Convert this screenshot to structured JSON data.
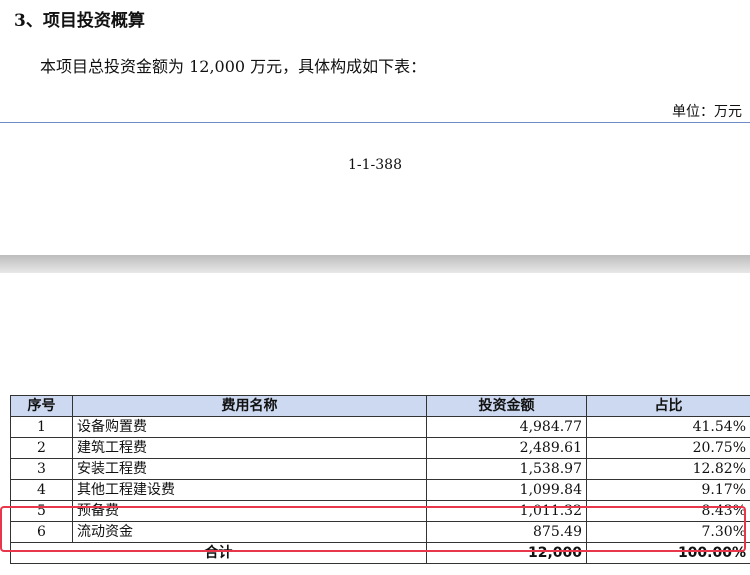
{
  "section_heading": "3、项目投资概算",
  "paragraph": "本项目总投资金额为 12,000 万元，具体构成如下表：",
  "unit_label": "单位：万元",
  "page_number": "1-1-388",
  "table": {
    "headers": [
      "序号",
      "费用名称",
      "投资金额",
      "占比"
    ],
    "rows": [
      [
        "1",
        "设备购置费",
        "4,984.77",
        "41.54%"
      ],
      [
        "2",
        "建筑工程费",
        "2,489.61",
        "20.75%"
      ],
      [
        "3",
        "安装工程费",
        "1,538.97",
        "12.82%"
      ],
      [
        "4",
        "其他工程建设费",
        "1,099.84",
        "9.17%"
      ],
      [
        "5",
        "预备费",
        "1,011.32",
        "8.43%"
      ],
      [
        "6",
        "流动资金",
        "875.49",
        "7.30%"
      ]
    ],
    "total": {
      "label": "合计",
      "amount": "12,000",
      "ratio": "100.00%"
    }
  },
  "colors": {
    "header_bg": "#ccd9f0",
    "highlight_border": "#e8364a",
    "rule": "#6d8bc4"
  }
}
